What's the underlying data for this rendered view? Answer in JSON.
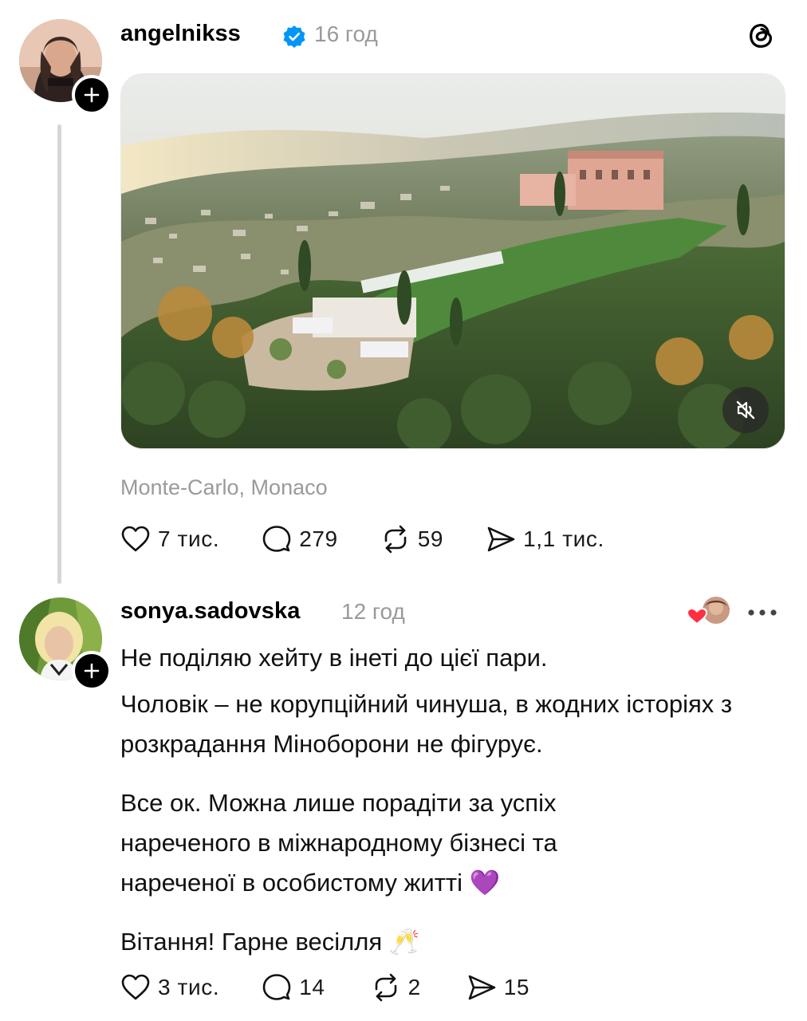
{
  "post1": {
    "username": "angelnikss",
    "time": "16 год",
    "location": "Monte-Carlo, Monaco",
    "actions": {
      "likes": "7 тис.",
      "replies": "279",
      "reposts": "59",
      "shares": "1,1 тис."
    }
  },
  "post2": {
    "username": "sonya.sadovska",
    "time": "12 год",
    "paragraphs": [
      "Не поділяю хейту в інеті до цієї пари.",
      "Чоловік – не корупційний чинуша, в жодних історіях з розкрадання Міноборони не фігурує.",
      "Все ок. Можна лише порадіти за успіх нареченого в міжнародному бізнесі та нареченої в особистому житті 💜",
      "Вітання! Гарне весілля 🥂"
    ],
    "actions": {
      "likes": "3 тис.",
      "replies": "14",
      "reposts": "2",
      "shares": "15"
    }
  },
  "icons": {
    "verified": "verified-badge-icon",
    "threads": "threads-logo-icon",
    "like": "heart-icon",
    "reply": "speech-bubble-icon",
    "repost": "repost-arrows-icon",
    "share": "send-icon",
    "mute": "speaker-muted-icon",
    "more": "ellipsis-icon"
  },
  "colors": {
    "verified": "#0095f6",
    "muted_text": "#9a9a9a",
    "thread_line": "#d6d6d6"
  }
}
